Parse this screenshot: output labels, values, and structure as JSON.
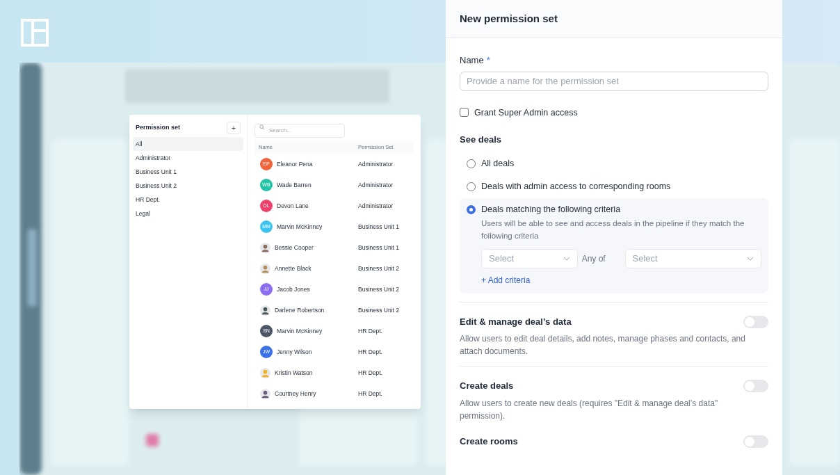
{
  "permission_sets": {
    "title": "Permission set",
    "add_label": "+",
    "items": [
      {
        "label": "All",
        "selected": true
      },
      {
        "label": "Administrator",
        "selected": false
      },
      {
        "label": "Business Unit 1",
        "selected": false
      },
      {
        "label": "Business Unit 2",
        "selected": false
      },
      {
        "label": "HR Dept.",
        "selected": false
      },
      {
        "label": "Legal",
        "selected": false
      }
    ]
  },
  "users": {
    "search": {
      "placeholder": "Search..."
    },
    "columns": [
      "Name",
      "Permission Set"
    ],
    "rows": [
      {
        "avatar": {
          "kind": "initials",
          "initials": "EP",
          "color": "#f0643c"
        },
        "name": "Eleanor Pena",
        "set": "Administrator"
      },
      {
        "avatar": {
          "kind": "initials",
          "initials": "WB",
          "color": "#22c3a6"
        },
        "name": "Wade Barren",
        "set": "Administrator"
      },
      {
        "avatar": {
          "kind": "initials",
          "initials": "DL",
          "color": "#f0416c"
        },
        "name": "Devon Lane",
        "set": "Administrator"
      },
      {
        "avatar": {
          "kind": "initials",
          "initials": "MM",
          "color": "#3cc3f0"
        },
        "name": "Marvin McKinney",
        "set": "Business Unit 1"
      },
      {
        "name": "Bessie Cooper",
        "set": "Business Unit 1"
      },
      {
        "name": "Annette Black",
        "set": "Business Unit 2"
      },
      {
        "avatar": {
          "kind": "initials",
          "initials": "JJ",
          "color": "#8c6cf0"
        },
        "name": "Jacob Jones",
        "set": "Business Unit 2"
      },
      {
        "name": "Darlene Robertson",
        "set": "Business Unit 2"
      },
      {
        "avatar": {
          "kind": "initials",
          "initials": "SN",
          "color": "#4b5563"
        },
        "name": "Marvin McKinney",
        "set": "HR Dept."
      },
      {
        "avatar": {
          "kind": "initials",
          "initials": "JW",
          "color": "#3b72e8"
        },
        "name": "Jenny Wilson",
        "set": "HR Dept."
      },
      {
        "name": "Kristin Watson",
        "set": "HR Dept."
      },
      {
        "name": "Courtney Henry",
        "set": "HR Dept."
      }
    ]
  },
  "panel": {
    "title": "New permission set",
    "name_field": {
      "label": "Name",
      "required_mark": "*",
      "placeholder": "Provide a name for the permission set"
    },
    "super_admin": {
      "label": "Grant Super Admin access",
      "checked": false
    },
    "see_deals": {
      "title": "See deals",
      "options": [
        {
          "label": "All deals",
          "selected": false
        },
        {
          "label": "Deals with admin access to corresponding rooms",
          "selected": false
        },
        {
          "label": "Deals matching the following criteria",
          "selected": true,
          "description": "Users will be able to see and access deals in the pipeline if they match the following criteria",
          "criteria": {
            "field_placeholder": "Select",
            "operator": "Any of",
            "value_placeholder": "Select",
            "add_label": "+ Add criteria"
          }
        }
      ]
    },
    "permissions": [
      {
        "title": "Edit & manage deal’s data",
        "on": false,
        "description": "Allow users to edit deal details, add notes, manage phases and contacts, and attach documents."
      },
      {
        "title": "Create deals",
        "on": false,
        "description": "Allow users to create new deals (requires \"Edit & manage deal’s data\" permission)."
      },
      {
        "title": "Create rooms",
        "on": false
      }
    ]
  }
}
